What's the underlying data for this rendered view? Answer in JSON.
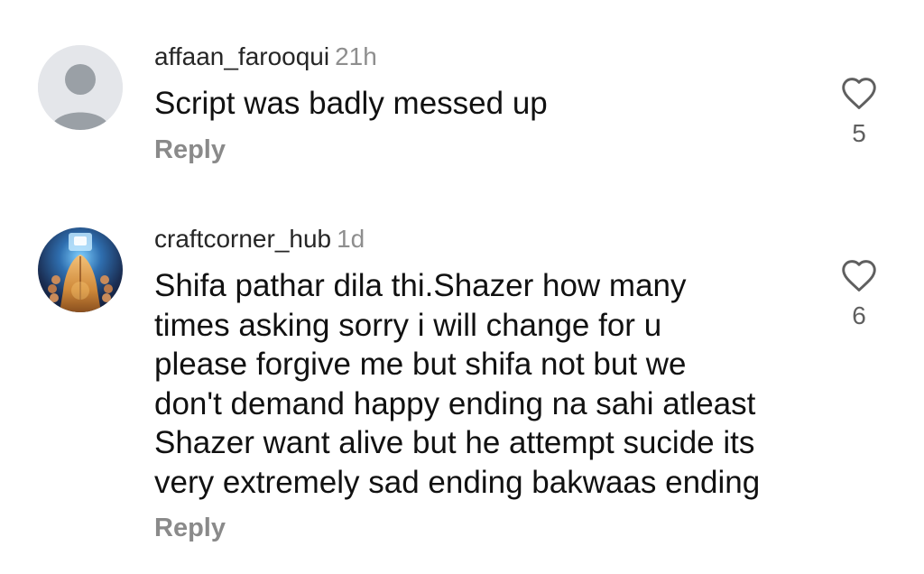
{
  "comments": [
    {
      "username": "affaan_farooqui",
      "time": "21h",
      "text": "Script was badly messed up",
      "reply_label": "Reply",
      "likes": "5",
      "avatar": "default-person-icon"
    },
    {
      "username": "craftcorner_hub",
      "time": "1d",
      "text": "Shifa pathar dila thi.Shazer how many\ntimes asking sorry i will change for u\nplease forgive me but shifa not but we\ndon't demand happy ending na sahi atleast\nShazer want alive but he attempt sucide its\nvery extremely sad ending bakwaas ending",
      "reply_label": "Reply",
      "likes": "6",
      "avatar": "praying-hands-photo"
    }
  ],
  "colors": {
    "text": "#111111",
    "username": "#262626",
    "muted": "#8e8e8e",
    "reply": "#8a8a8a",
    "icon": "#5f5f5f",
    "avatar_bg": "#e4e6ea",
    "avatar_fg": "#9aa0a6"
  }
}
